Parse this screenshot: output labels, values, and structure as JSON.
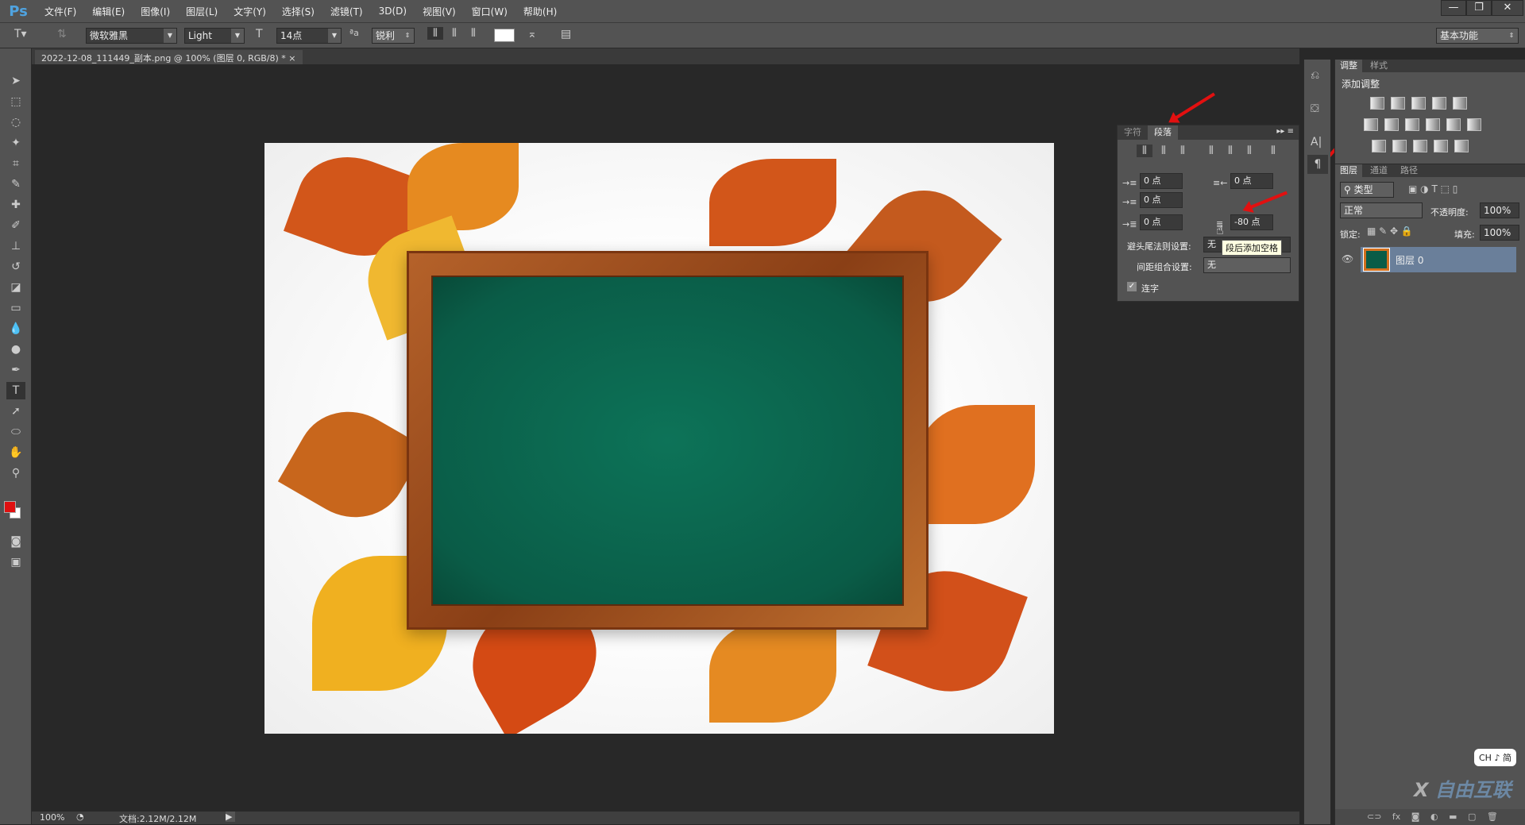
{
  "app": {
    "logo": "Ps",
    "window_controls": [
      "—",
      "❐",
      "✕"
    ]
  },
  "menu": [
    "文件(F)",
    "编辑(E)",
    "图像(I)",
    "图层(L)",
    "文字(Y)",
    "选择(S)",
    "滤镜(T)",
    "3D(D)",
    "视图(V)",
    "窗口(W)",
    "帮助(H)"
  ],
  "options": {
    "font_family": "微软雅黑",
    "font_style": "Light",
    "font_size": "14点",
    "antialias": "锐利",
    "workspace": "基本功能",
    "text_color": "#ffffff"
  },
  "document": {
    "tab_title": "2022-12-08_111449_副本.png @ 100% (图层 0, RGB/8) *",
    "close": "×"
  },
  "status": {
    "zoom": "100%",
    "doc_size": "文档:2.12M/2.12M"
  },
  "paragraph_panel": {
    "tabs": [
      "字符",
      "段落"
    ],
    "active_tab": "段落",
    "indent_left": "0 点",
    "indent_right": "0 点",
    "indent_first": "0 点",
    "space_before": "0 点",
    "space_after": "-80 点",
    "kinsoku_label": "避头尾法则设置:",
    "kinsoku_value": "无",
    "mojikumi_label": "间距组合设置:",
    "mojikumi_value": "无",
    "hyphenate_label": "连字",
    "hyphenate_checked": true,
    "tooltip": "段后添加空格"
  },
  "adjust_panel": {
    "tabs": [
      "调整",
      "样式"
    ],
    "title": "添加调整"
  },
  "layers_panel": {
    "tabs": [
      "图层",
      "通道",
      "路径"
    ],
    "filter": "类型",
    "blend_mode": "正常",
    "opacity_label": "不透明度:",
    "opacity": "100%",
    "lock_label": "锁定:",
    "fill_label": "填充:",
    "fill": "100%",
    "layers": [
      {
        "name": "图层 0",
        "visible": true
      }
    ]
  },
  "ime": "CH ♪ 简",
  "watermark": "自由互联",
  "colors": {
    "foreground": "#e01010",
    "background": "#ffffff",
    "board": "#0a5c47",
    "frame": "#a0521f",
    "annotation_arrow": "#e21010"
  }
}
